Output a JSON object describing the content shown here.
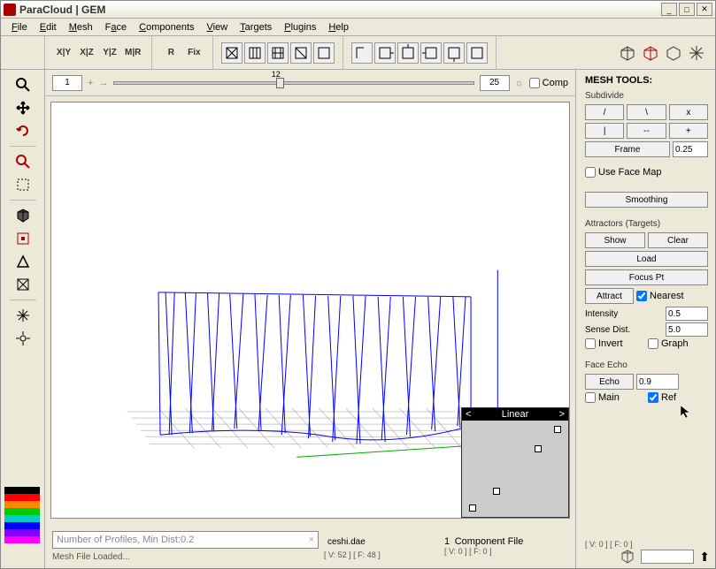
{
  "title": "ParaCloud | GEM",
  "menu": [
    "File",
    "Edit",
    "Mesh",
    "Face",
    "Components",
    "View",
    "Targets",
    "Plugins",
    "Help"
  ],
  "view_toolbar": {
    "axis_buttons": [
      "X|Y",
      "X|Z",
      "Y|Z",
      "M|R"
    ],
    "r_button": "R",
    "fix_button": "Fix"
  },
  "slider": {
    "left_value": "1",
    "mark_value": "12",
    "right_value": "25",
    "comp_label": "Comp"
  },
  "right": {
    "title": "MESH TOOLS:",
    "subdivide": "Subdivide",
    "row1": [
      "/",
      "\\",
      "x"
    ],
    "row2": [
      "|",
      "--",
      "+"
    ],
    "frame_btn": "Frame",
    "frame_val": "0.25",
    "use_face_map": "Use Face Map",
    "smoothing": "Smoothing",
    "attractors": "Attractors (Targets)",
    "show": "Show",
    "clear": "Clear",
    "load": "Load",
    "focus": "Focus Pt",
    "attract": "Attract",
    "nearest": "Nearest",
    "intensity": "Intensity",
    "intensity_v": "0.5",
    "sense": "Sense Dist.",
    "sense_v": "5.0",
    "invert": "Invert",
    "graph": "Graph",
    "face_echo": "Face Echo",
    "echo": "Echo",
    "echo_v": "0.9",
    "main": "Main",
    "ref": "Ref",
    "vf": "[ V: 0 ] [ F: 0 ]"
  },
  "linear": {
    "title": "Linear"
  },
  "status": {
    "profiles": "Number of Profiles, Min Dist:0.2",
    "file": "ceshi.dae",
    "vf": "[ V: 52 ] [ F: 48 ]",
    "comp_num": "1",
    "comp_lbl": "Component File",
    "vf2": "[ V: 0 ] [ F: 0 ]",
    "msg": "Mesh File Loaded..."
  }
}
